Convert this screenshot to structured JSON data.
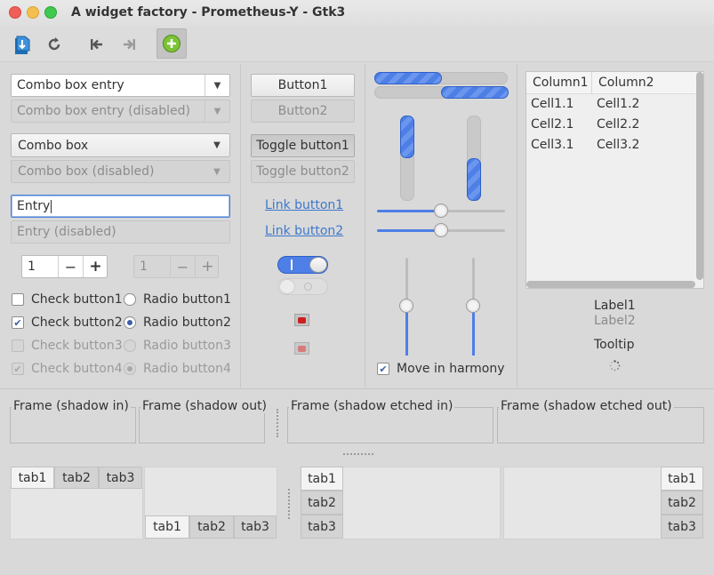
{
  "window": {
    "title": "A widget factory - Prometheus-Y - Gtk3",
    "controls": {
      "close_color": "#f05f57",
      "minimize_color": "#f4bf4f",
      "maximize_color": "#3fc950"
    }
  },
  "toolbar": {
    "icons": [
      "document-icon",
      "refresh-icon",
      "go-first-icon",
      "go-last-icon",
      "add-icon"
    ]
  },
  "column1": {
    "combo_entry": "Combo box entry",
    "combo_entry_disabled": "Combo box entry (disabled)",
    "combo_box": "Combo box",
    "combo_box_disabled": "Combo box (disabled)",
    "entry_value": "Entry",
    "entry_disabled": "Entry (disabled)",
    "spin1_value": "1",
    "spin2_value": "1",
    "spin_minus": "−",
    "spin_plus": "+",
    "checks": [
      {
        "label": "Check button1",
        "checked": false,
        "disabled": false
      },
      {
        "label": "Check button2",
        "checked": true,
        "disabled": false
      },
      {
        "label": "Check button3",
        "checked": false,
        "disabled": true
      },
      {
        "label": "Check button4",
        "checked": true,
        "disabled": true
      }
    ],
    "radios": [
      {
        "label": "Radio button1",
        "selected": false,
        "disabled": false
      },
      {
        "label": "Radio button2",
        "selected": true,
        "disabled": false
      },
      {
        "label": "Radio button3",
        "selected": false,
        "disabled": true
      },
      {
        "label": "Radio button4",
        "selected": true,
        "disabled": true
      }
    ]
  },
  "column2": {
    "button1": "Button1",
    "button2": "Button2",
    "toggle1": "Toggle button1",
    "toggle2": "Toggle button2",
    "link1": "Link button1",
    "link2": "Link button2",
    "switch1_on": true,
    "switch2_on": false
  },
  "column3": {
    "move_in_harmony": "Move in harmony",
    "move_in_harmony_checked": true,
    "hscale1_fraction": 0.5,
    "hscale2_fraction": 0.5,
    "vscale1_fraction": 0.5,
    "vscale2_fraction": 0.5
  },
  "column4": {
    "tree": {
      "columns": [
        "Column1",
        "Column2"
      ],
      "rows": [
        [
          "Cell1.1",
          "Cell1.2"
        ],
        [
          "Cell2.1",
          "Cell2.2"
        ],
        [
          "Cell3.1",
          "Cell3.2"
        ]
      ]
    },
    "label1": "Label1",
    "label2": "Label2",
    "tooltip": "Tooltip"
  },
  "frames": {
    "shadow_in": "Frame (shadow in)",
    "shadow_out": "Frame (shadow out)",
    "shadow_etched_in": "Frame (shadow etched in)",
    "shadow_etched_out": "Frame (shadow etched out)"
  },
  "tabs": {
    "labels": [
      "tab1",
      "tab2",
      "tab3"
    ]
  },
  "colors": {
    "accent": "#4d7fe6",
    "link": "#3d78cc",
    "background": "#d9d9d9"
  }
}
